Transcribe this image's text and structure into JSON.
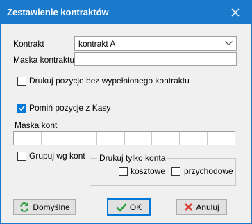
{
  "window": {
    "title": "Zestawienie kontraktów"
  },
  "kontrakt": {
    "label": "Kontrakt",
    "value": "kontrakt A"
  },
  "maska_kontraktu": {
    "label": "Maska kontraktu",
    "value": ""
  },
  "drukuj_bez": {
    "label": "Drukuj pozycje bez wypełnionego kontraktu",
    "checked": false
  },
  "pomin_kasy": {
    "label": "Pomiń pozycje z Kasy",
    "checked": true
  },
  "maska_kont": {
    "label": "Maska kont"
  },
  "grupuj": {
    "label": "Grupuj wg kont",
    "checked": false
  },
  "drukuj_tylko": {
    "legend": "Drukuj tylko konta",
    "kosztowe": {
      "label": "kosztowe",
      "checked": false
    },
    "przychodowe": {
      "label": "przychodowe",
      "checked": false
    }
  },
  "buttons": {
    "domyslne": {
      "prefix": "Do",
      "mnemonic": "m",
      "suffix": "yślne"
    },
    "ok": {
      "mnemonic": "O",
      "suffix": "K"
    },
    "anuluj": {
      "mnemonic": "A",
      "suffix": "nuluj"
    }
  },
  "colors": {
    "accent": "#1979ca",
    "check": "#0078d7"
  }
}
